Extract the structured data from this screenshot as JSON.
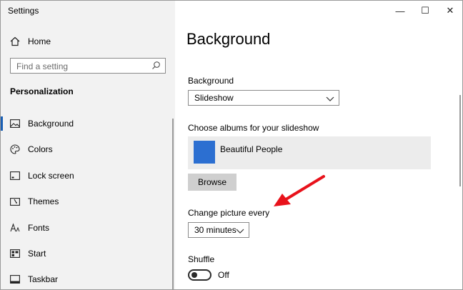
{
  "window": {
    "title": "Settings",
    "controls": {
      "minimize": "—",
      "maximize": "☐",
      "close": "✕"
    }
  },
  "sidebar": {
    "home_label": "Home",
    "search_placeholder": "Find a setting",
    "section_title": "Personalization",
    "items": [
      {
        "label": "Background",
        "icon": "picture-icon",
        "active": true
      },
      {
        "label": "Colors",
        "icon": "palette-icon"
      },
      {
        "label": "Lock screen",
        "icon": "lock-screen-icon"
      },
      {
        "label": "Themes",
        "icon": "themes-icon"
      },
      {
        "label": "Fonts",
        "icon": "fonts-icon"
      },
      {
        "label": "Start",
        "icon": "start-icon"
      },
      {
        "label": "Taskbar",
        "icon": "taskbar-icon"
      }
    ]
  },
  "main": {
    "page_title": "Background",
    "background_label": "Background",
    "background_value": "Slideshow",
    "albums_label": "Choose albums for your slideshow",
    "album_name": "Beautiful People",
    "browse_label": "Browse",
    "change_label": "Change picture every",
    "change_value": "30 minutes",
    "shuffle_label": "Shuffle",
    "shuffle_state": "Off"
  },
  "colors": {
    "accent": "#1a5fb4",
    "album_thumb": "#2c6fd1",
    "arrow": "#e8121b"
  }
}
